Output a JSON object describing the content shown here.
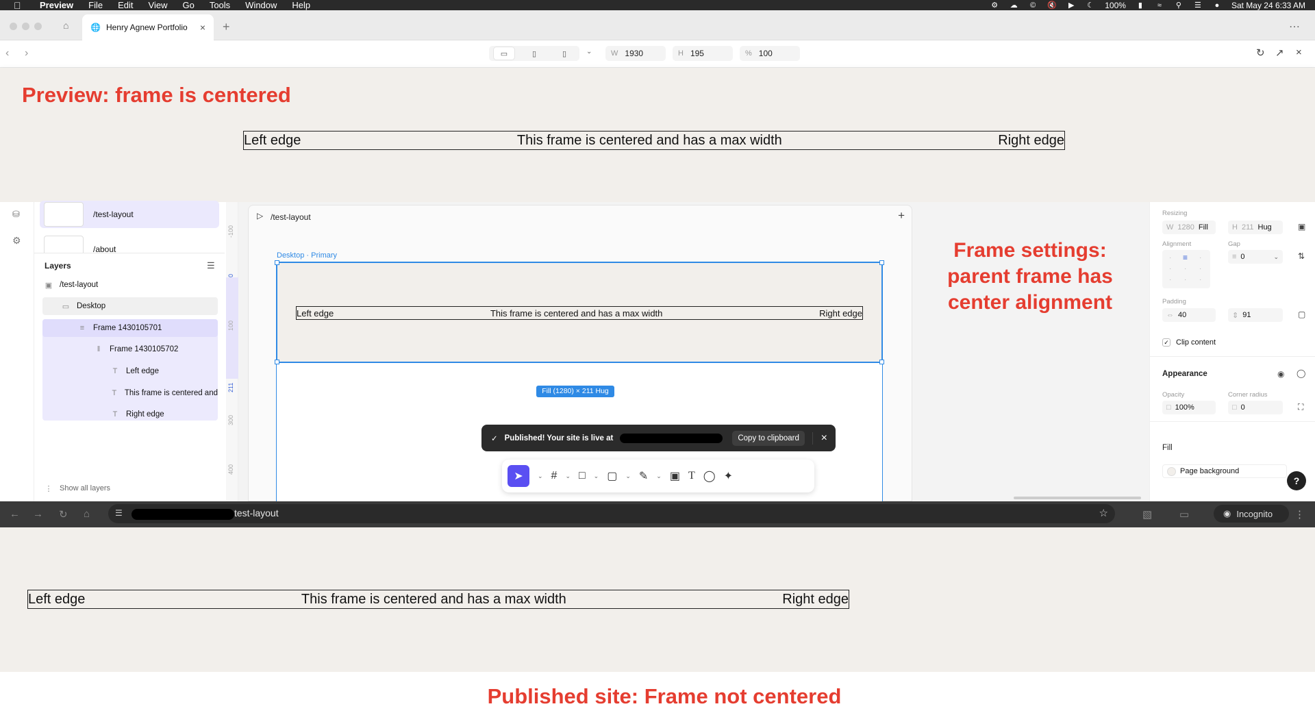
{
  "menubar": {
    "app": "Preview",
    "items": [
      "File",
      "Edit",
      "View",
      "Go",
      "Tools",
      "Window",
      "Help"
    ],
    "battery": "100%",
    "datetime": "Sat May 24  6:33 AM"
  },
  "top_browser": {
    "tab_title": "Henry Agnew Portfolio",
    "width_label": "W",
    "width_value": "1930",
    "height_label": "H",
    "height_value": "195",
    "zoom_label": "%",
    "zoom_value": "100"
  },
  "preview": {
    "annotation": "Preview: frame is centered",
    "left_edge": "Left edge",
    "center_text": "This frame is centered and has a max width",
    "right_edge": "Right edge"
  },
  "editor": {
    "pages": [
      "/test-layout",
      "/about"
    ],
    "layers_title": "Layers",
    "layers": [
      {
        "label": "/test-layout",
        "icon": "page-icon"
      },
      {
        "label": "Desktop",
        "icon": "desktop-icon"
      },
      {
        "label": "Frame 1430105701",
        "icon": "stack-icon"
      },
      {
        "label": "Frame 1430105702",
        "icon": "stack-horizontal-icon"
      },
      {
        "label": "Left edge",
        "icon": "text-icon"
      },
      {
        "label": "This frame is centered and",
        "icon": "text-icon"
      },
      {
        "label": "Right edge",
        "icon": "text-icon"
      }
    ],
    "show_all_layers": "Show all layers",
    "canvas_page": "/test-layout",
    "breakpoint_label": "Desktop · Primary",
    "size_badge": "Fill (1280) × 211 Hug",
    "ruler_ticks": [
      "-100",
      "0",
      "100",
      "211",
      "300",
      "400"
    ],
    "canvas_left_edge": "Left edge",
    "canvas_center_text": "This frame is centered and has a max width",
    "canvas_right_edge": "Right edge",
    "annotation": "Frame settings: parent frame has center alignment",
    "toast": {
      "message": "Published! Your site is live at",
      "copy_button": "Copy to clipboard"
    }
  },
  "right_panel": {
    "resizing_label": "Resizing",
    "w_label": "W",
    "w_value": "1280",
    "w_mode": "Fill",
    "h_label": "H",
    "h_value": "211",
    "h_mode": "Hug",
    "alignment_label": "Alignment",
    "gap_label": "Gap",
    "gap_value": "0",
    "padding_label": "Padding",
    "padding_h": "40",
    "padding_v": "91",
    "clip_content": "Clip content",
    "appearance_label": "Appearance",
    "opacity_label": "Opacity",
    "opacity_value": "100%",
    "corner_radius_label": "Corner radius",
    "corner_radius_value": "0",
    "fill_label": "Fill",
    "fill_value": "Page background"
  },
  "bottom_browser": {
    "url_suffix": "test-layout",
    "incognito": "Incognito"
  },
  "published": {
    "left_edge": "Left edge",
    "center_text": "This frame is centered and has a max width",
    "right_edge": "Right edge",
    "annotation": "Published site: Frame not centered"
  },
  "colors": {
    "annotation_red": "#e53d30",
    "selection_blue": "#2f8ae5",
    "tool_active": "#5a4ff2",
    "page_background": "#f2efeb"
  }
}
